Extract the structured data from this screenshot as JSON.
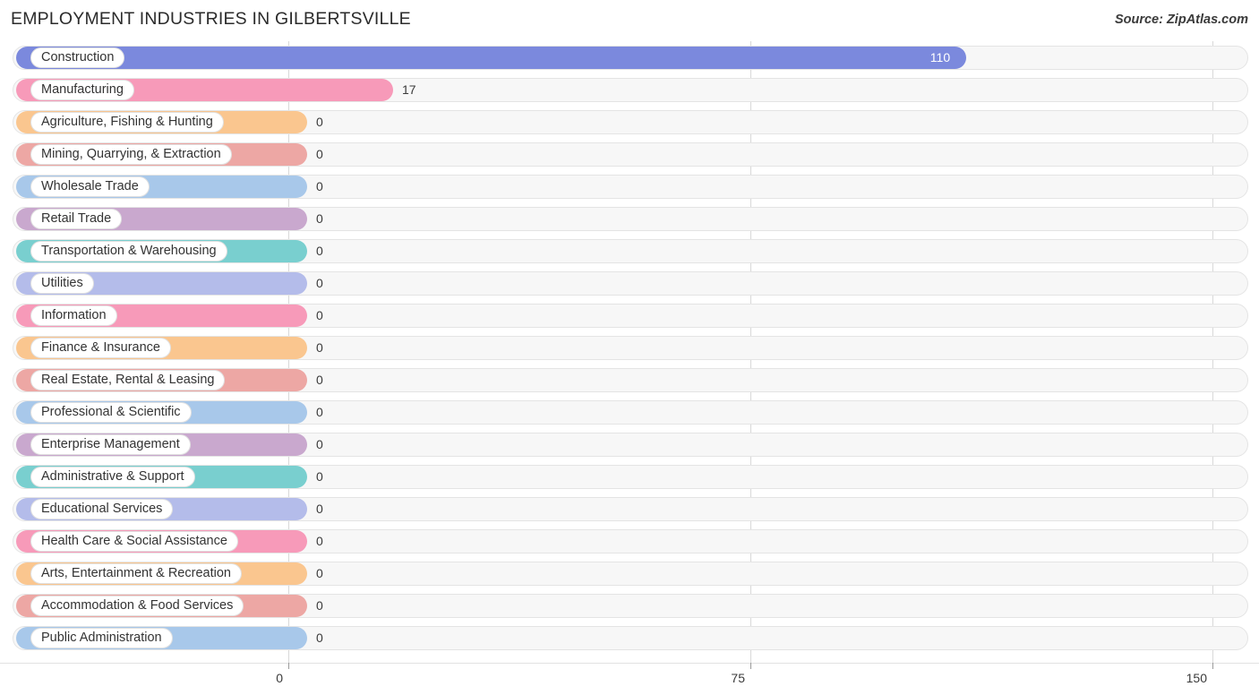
{
  "header": {
    "title": "EMPLOYMENT INDUSTRIES IN GILBERTSVILLE",
    "source": "Source: ZipAtlas.com"
  },
  "chart_data": {
    "type": "bar",
    "orientation": "horizontal",
    "title": "EMPLOYMENT INDUSTRIES IN GILBERTSVILLE",
    "xlabel": "",
    "ylabel": "",
    "xlim": [
      0,
      150
    ],
    "xticks": [
      0,
      75,
      150
    ],
    "xtick_labels": [
      "0",
      "75",
      "150"
    ],
    "grid": true,
    "legend": false,
    "categories": [
      "Construction",
      "Manufacturing",
      "Agriculture, Fishing & Hunting",
      "Mining, Quarrying, & Extraction",
      "Wholesale Trade",
      "Retail Trade",
      "Transportation & Warehousing",
      "Utilities",
      "Information",
      "Finance & Insurance",
      "Real Estate, Rental & Leasing",
      "Professional & Scientific",
      "Enterprise Management",
      "Administrative & Support",
      "Educational Services",
      "Health Care & Social Assistance",
      "Arts, Entertainment & Recreation",
      "Accommodation & Food Services",
      "Public Administration"
    ],
    "values": [
      110,
      17,
      0,
      0,
      0,
      0,
      0,
      0,
      0,
      0,
      0,
      0,
      0,
      0,
      0,
      0,
      0,
      0,
      0
    ],
    "value_labels": [
      "110",
      "17",
      "0",
      "0",
      "0",
      "0",
      "0",
      "0",
      "0",
      "0",
      "0",
      "0",
      "0",
      "0",
      "0",
      "0",
      "0",
      "0",
      "0"
    ],
    "colors": [
      "#7b89dd",
      "#f79ab9",
      "#fac68f",
      "#eda7a4",
      "#a8c8ea",
      "#c9a8ce",
      "#79cfcf",
      "#b4bcea",
      "#f79ab9",
      "#fac68f",
      "#eda7a4",
      "#a8c8ea",
      "#c9a8ce",
      "#79cfcf",
      "#b4bcea",
      "#f79ab9",
      "#fac68f",
      "#eda7a4",
      "#a8c8ea"
    ]
  },
  "axis": {
    "tick_labels": [
      "0",
      "75",
      "150"
    ]
  }
}
